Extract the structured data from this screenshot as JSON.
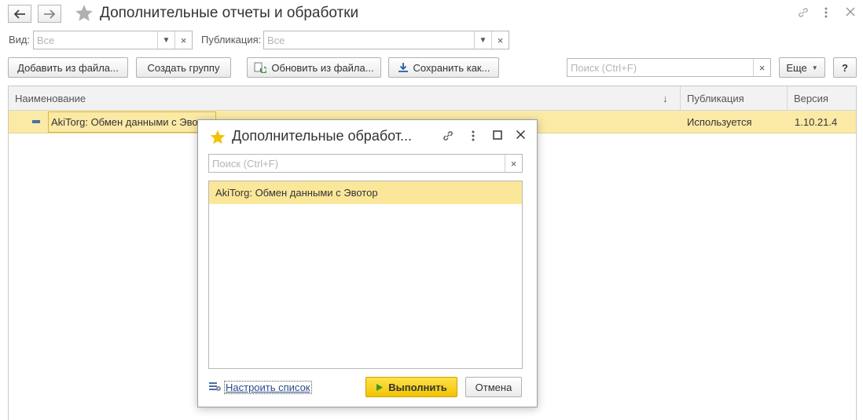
{
  "window": {
    "title": "Дополнительные отчеты и обработки",
    "back_icon": "arrow-left-icon",
    "forward_icon": "arrow-right-icon",
    "favorite_icon": "star-icon",
    "link_icon": "link-icon",
    "more_icon": "vertical-dots-icon",
    "close_icon": "close-icon"
  },
  "filters": {
    "kind_label": "Вид:",
    "kind_value": "Все",
    "publication_label": "Публикация:",
    "publication_value": "Все"
  },
  "toolbar": {
    "add_from_file": "Добавить из файла...",
    "create_group": "Создать группу",
    "update_from_file": "Обновить из файла...",
    "save_as": "Сохранить как...",
    "search_placeholder": "Поиск (Ctrl+F)",
    "more": "Еще",
    "help": "?"
  },
  "table": {
    "columns": [
      "Наименование",
      "Публикация",
      "Версия"
    ],
    "rows": [
      {
        "name": "AkiTorg: Обмен данными с Эвотор",
        "publication": "Используется",
        "version": "1.10.21.4"
      }
    ]
  },
  "dialog": {
    "title": "Дополнительные обработ...",
    "search_placeholder": "Поиск (Ctrl+F)",
    "items": [
      "AkiTorg: Обмен данными с Эвотор"
    ],
    "configure_link": "Настроить список",
    "execute_button": "Выполнить",
    "cancel_button": "Отмена"
  },
  "colors": {
    "selected_row": "#fbeaa6",
    "execute_button": "#f5d20a",
    "star_active": "#f2c200",
    "star_inactive": "#b0b0b0"
  }
}
